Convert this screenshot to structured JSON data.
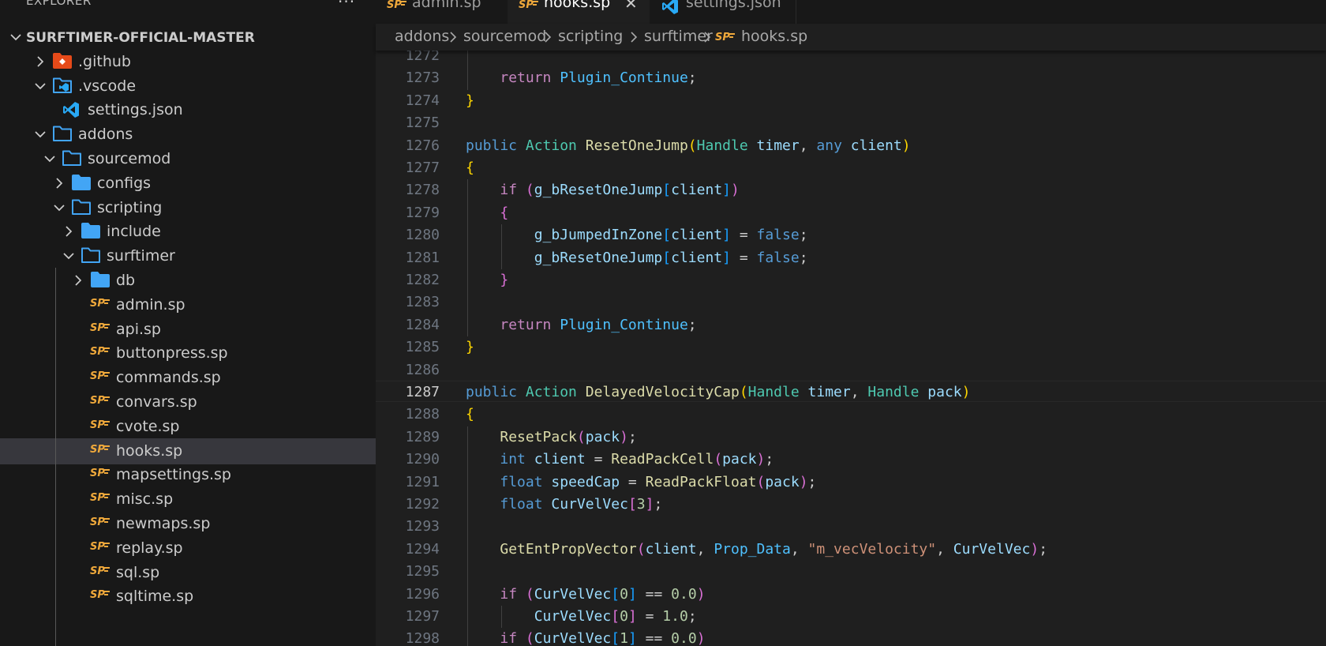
{
  "sidebar": {
    "explorer_title": "EXPLORER",
    "more_label": "···",
    "tree": [
      {
        "label": "SURFTIMER-OFFICIAL-MASTER",
        "depth": 0,
        "kind": "root",
        "chevron": "down",
        "icon": "none"
      },
      {
        "label": ".github",
        "depth": 1,
        "kind": "folder",
        "chevron": "right",
        "icon": "git-folder-icon"
      },
      {
        "label": ".vscode",
        "depth": 1,
        "kind": "folder",
        "chevron": "down",
        "icon": "vscode-folder-icon"
      },
      {
        "label": "settings.json",
        "depth": 2,
        "kind": "file",
        "chevron": "none",
        "icon": "vscode-file-icon"
      },
      {
        "label": "addons",
        "depth": 1,
        "kind": "folder",
        "chevron": "down",
        "icon": "folder-open-icon"
      },
      {
        "label": "sourcemod",
        "depth": 2,
        "kind": "folder",
        "chevron": "down",
        "icon": "folder-open-icon"
      },
      {
        "label": "configs",
        "depth": 3,
        "kind": "folder",
        "chevron": "right",
        "icon": "folder-icon"
      },
      {
        "label": "scripting",
        "depth": 3,
        "kind": "folder",
        "chevron": "down",
        "icon": "folder-open-icon"
      },
      {
        "label": "include",
        "depth": 4,
        "kind": "folder",
        "chevron": "right",
        "icon": "folder-icon"
      },
      {
        "label": "surftimer",
        "depth": 4,
        "kind": "folder",
        "chevron": "down",
        "icon": "folder-open-icon"
      },
      {
        "label": "db",
        "depth": 5,
        "kind": "folder",
        "chevron": "right",
        "icon": "folder-icon"
      },
      {
        "label": "admin.sp",
        "depth": 5,
        "kind": "file",
        "chevron": "none",
        "icon": "sp-file-icon"
      },
      {
        "label": "api.sp",
        "depth": 5,
        "kind": "file",
        "chevron": "none",
        "icon": "sp-file-icon"
      },
      {
        "label": "buttonpress.sp",
        "depth": 5,
        "kind": "file",
        "chevron": "none",
        "icon": "sp-file-icon"
      },
      {
        "label": "commands.sp",
        "depth": 5,
        "kind": "file",
        "chevron": "none",
        "icon": "sp-file-icon"
      },
      {
        "label": "convars.sp",
        "depth": 5,
        "kind": "file",
        "chevron": "none",
        "icon": "sp-file-icon"
      },
      {
        "label": "cvote.sp",
        "depth": 5,
        "kind": "file",
        "chevron": "none",
        "icon": "sp-file-icon"
      },
      {
        "label": "hooks.sp",
        "depth": 5,
        "kind": "file",
        "chevron": "none",
        "icon": "sp-file-icon",
        "selected": true
      },
      {
        "label": "mapsettings.sp",
        "depth": 5,
        "kind": "file",
        "chevron": "none",
        "icon": "sp-file-icon"
      },
      {
        "label": "misc.sp",
        "depth": 5,
        "kind": "file",
        "chevron": "none",
        "icon": "sp-file-icon"
      },
      {
        "label": "newmaps.sp",
        "depth": 5,
        "kind": "file",
        "chevron": "none",
        "icon": "sp-file-icon"
      },
      {
        "label": "replay.sp",
        "depth": 5,
        "kind": "file",
        "chevron": "none",
        "icon": "sp-file-icon"
      },
      {
        "label": "sql.sp",
        "depth": 5,
        "kind": "file",
        "chevron": "none",
        "icon": "sp-file-icon"
      },
      {
        "label": "sqltime.sp",
        "depth": 5,
        "kind": "file",
        "chevron": "none",
        "icon": "sp-file-icon"
      }
    ]
  },
  "tabs": [
    {
      "label": "admin.sp",
      "icon": "sp-file-icon",
      "active": false
    },
    {
      "label": "hooks.sp",
      "icon": "sp-file-icon",
      "active": true,
      "close": "✕"
    },
    {
      "label": "settings.json",
      "icon": "vscode-file-icon",
      "active": false
    }
  ],
  "breadcrumb": [
    "addons",
    "sourcemod",
    "scripting",
    "surftimer",
    "hooks.sp"
  ],
  "editor": {
    "active_line": 1287,
    "lines": [
      {
        "n": 1272,
        "indent": 1,
        "t": []
      },
      {
        "n": 1273,
        "indent": 1,
        "t": [
          [
            "    ",
            "p"
          ],
          [
            "return",
            "ctrl"
          ],
          [
            " ",
            "p"
          ],
          [
            "Plugin_Continue",
            "const"
          ],
          [
            ";",
            "p"
          ]
        ]
      },
      {
        "n": 1274,
        "indent": 0,
        "t": [
          [
            "}",
            "br1"
          ]
        ]
      },
      {
        "n": 1275,
        "indent": 0,
        "t": []
      },
      {
        "n": 1276,
        "indent": 0,
        "t": [
          [
            "public",
            "key"
          ],
          [
            " ",
            "p"
          ],
          [
            "Action",
            "type"
          ],
          [
            " ",
            "p"
          ],
          [
            "ResetOneJump",
            "fn"
          ],
          [
            "(",
            "br1"
          ],
          [
            "Handle",
            "type"
          ],
          [
            " ",
            "p"
          ],
          [
            "timer",
            "var"
          ],
          [
            ", ",
            "p"
          ],
          [
            "any",
            "key"
          ],
          [
            " ",
            "p"
          ],
          [
            "client",
            "var"
          ],
          [
            ")",
            "br1"
          ]
        ]
      },
      {
        "n": 1277,
        "indent": 0,
        "t": [
          [
            "{",
            "br1"
          ]
        ]
      },
      {
        "n": 1278,
        "indent": 1,
        "t": [
          [
            "    ",
            "p"
          ],
          [
            "if",
            "ctrl"
          ],
          [
            " ",
            "p"
          ],
          [
            "(",
            "br2"
          ],
          [
            "g_bResetOneJump",
            "var"
          ],
          [
            "[",
            "br3"
          ],
          [
            "client",
            "var"
          ],
          [
            "]",
            "br3"
          ],
          [
            ")",
            "br2"
          ]
        ]
      },
      {
        "n": 1279,
        "indent": 1,
        "t": [
          [
            "    ",
            "p"
          ],
          [
            "{",
            "br2"
          ]
        ]
      },
      {
        "n": 1280,
        "indent": 2,
        "t": [
          [
            "        ",
            "p"
          ],
          [
            "g_bJumpedInZone",
            "var"
          ],
          [
            "[",
            "br3"
          ],
          [
            "client",
            "var"
          ],
          [
            "]",
            "br3"
          ],
          [
            " = ",
            "p"
          ],
          [
            "false",
            "key"
          ],
          [
            ";",
            "p"
          ]
        ]
      },
      {
        "n": 1281,
        "indent": 2,
        "t": [
          [
            "        ",
            "p"
          ],
          [
            "g_bResetOneJump",
            "var"
          ],
          [
            "[",
            "br3"
          ],
          [
            "client",
            "var"
          ],
          [
            "]",
            "br3"
          ],
          [
            " = ",
            "p"
          ],
          [
            "false",
            "key"
          ],
          [
            ";",
            "p"
          ]
        ]
      },
      {
        "n": 1282,
        "indent": 1,
        "t": [
          [
            "    ",
            "p"
          ],
          [
            "}",
            "br2"
          ]
        ]
      },
      {
        "n": 1283,
        "indent": 1,
        "t": []
      },
      {
        "n": 1284,
        "indent": 1,
        "t": [
          [
            "    ",
            "p"
          ],
          [
            "return",
            "ctrl"
          ],
          [
            " ",
            "p"
          ],
          [
            "Plugin_Continue",
            "const"
          ],
          [
            ";",
            "p"
          ]
        ]
      },
      {
        "n": 1285,
        "indent": 0,
        "t": [
          [
            "}",
            "br1"
          ]
        ]
      },
      {
        "n": 1286,
        "indent": 0,
        "t": []
      },
      {
        "n": 1287,
        "indent": 0,
        "t": [
          [
            "public",
            "key"
          ],
          [
            " ",
            "p"
          ],
          [
            "Action",
            "type"
          ],
          [
            " ",
            "p"
          ],
          [
            "DelayedVelocityCap",
            "fn"
          ],
          [
            "(",
            "br1"
          ],
          [
            "Handle",
            "type"
          ],
          [
            " ",
            "p"
          ],
          [
            "timer",
            "var"
          ],
          [
            ", ",
            "p"
          ],
          [
            "Handle",
            "type"
          ],
          [
            " ",
            "p"
          ],
          [
            "pack",
            "var"
          ],
          [
            ")",
            "br1"
          ]
        ]
      },
      {
        "n": 1288,
        "indent": 0,
        "t": [
          [
            "{",
            "br1"
          ]
        ]
      },
      {
        "n": 1289,
        "indent": 1,
        "t": [
          [
            "    ",
            "p"
          ],
          [
            "ResetPack",
            "fn"
          ],
          [
            "(",
            "br2"
          ],
          [
            "pack",
            "var"
          ],
          [
            ")",
            "br2"
          ],
          [
            ";",
            "p"
          ]
        ]
      },
      {
        "n": 1290,
        "indent": 1,
        "t": [
          [
            "    ",
            "p"
          ],
          [
            "int",
            "key"
          ],
          [
            " ",
            "p"
          ],
          [
            "client",
            "var"
          ],
          [
            " = ",
            "p"
          ],
          [
            "ReadPackCell",
            "fn"
          ],
          [
            "(",
            "br2"
          ],
          [
            "pack",
            "var"
          ],
          [
            ")",
            "br2"
          ],
          [
            ";",
            "p"
          ]
        ]
      },
      {
        "n": 1291,
        "indent": 1,
        "t": [
          [
            "    ",
            "p"
          ],
          [
            "float",
            "key"
          ],
          [
            " ",
            "p"
          ],
          [
            "speedCap",
            "var"
          ],
          [
            " = ",
            "p"
          ],
          [
            "ReadPackFloat",
            "fn"
          ],
          [
            "(",
            "br2"
          ],
          [
            "pack",
            "var"
          ],
          [
            ")",
            "br2"
          ],
          [
            ";",
            "p"
          ]
        ]
      },
      {
        "n": 1292,
        "indent": 1,
        "t": [
          [
            "    ",
            "p"
          ],
          [
            "float",
            "key"
          ],
          [
            " ",
            "p"
          ],
          [
            "CurVelVec",
            "var"
          ],
          [
            "[",
            "br2"
          ],
          [
            "3",
            "num"
          ],
          [
            "]",
            "br2"
          ],
          [
            ";",
            "p"
          ]
        ]
      },
      {
        "n": 1293,
        "indent": 1,
        "t": []
      },
      {
        "n": 1294,
        "indent": 1,
        "t": [
          [
            "    ",
            "p"
          ],
          [
            "GetEntPropVector",
            "fn"
          ],
          [
            "(",
            "br2"
          ],
          [
            "client",
            "var"
          ],
          [
            ", ",
            "p"
          ],
          [
            "Prop_Data",
            "const"
          ],
          [
            ", ",
            "p"
          ],
          [
            "\"m_vecVelocity\"",
            "str"
          ],
          [
            ", ",
            "p"
          ],
          [
            "CurVelVec",
            "var"
          ],
          [
            ")",
            "br2"
          ],
          [
            ";",
            "p"
          ]
        ]
      },
      {
        "n": 1295,
        "indent": 1,
        "t": []
      },
      {
        "n": 1296,
        "indent": 1,
        "t": [
          [
            "    ",
            "p"
          ],
          [
            "if",
            "ctrl"
          ],
          [
            " ",
            "p"
          ],
          [
            "(",
            "br2"
          ],
          [
            "CurVelVec",
            "var"
          ],
          [
            "[",
            "br3"
          ],
          [
            "0",
            "num"
          ],
          [
            "]",
            "br3"
          ],
          [
            " == ",
            "p"
          ],
          [
            "0.0",
            "num"
          ],
          [
            ")",
            "br2"
          ]
        ]
      },
      {
        "n": 1297,
        "indent": 2,
        "t": [
          [
            "        ",
            "p"
          ],
          [
            "CurVelVec",
            "var"
          ],
          [
            "[",
            "br2"
          ],
          [
            "0",
            "num"
          ],
          [
            "]",
            "br2"
          ],
          [
            " = ",
            "p"
          ],
          [
            "1.0",
            "num"
          ],
          [
            ";",
            "p"
          ]
        ]
      },
      {
        "n": 1298,
        "indent": 1,
        "t": [
          [
            "    ",
            "p"
          ],
          [
            "if",
            "ctrl"
          ],
          [
            " ",
            "p"
          ],
          [
            "(",
            "br2"
          ],
          [
            "CurVelVec",
            "var"
          ],
          [
            "[",
            "br3"
          ],
          [
            "1",
            "num"
          ],
          [
            "]",
            "br3"
          ],
          [
            " == ",
            "p"
          ],
          [
            "0.0",
            "num"
          ],
          [
            ")",
            "br2"
          ]
        ]
      }
    ]
  },
  "colors": {
    "sidebar_bg": "#181818",
    "editor_bg": "#1f1f1f",
    "selection": "#37373d",
    "folder": "#42a5f5",
    "git_folder": "#e64a19",
    "sp_icon": "#f0a93b"
  }
}
